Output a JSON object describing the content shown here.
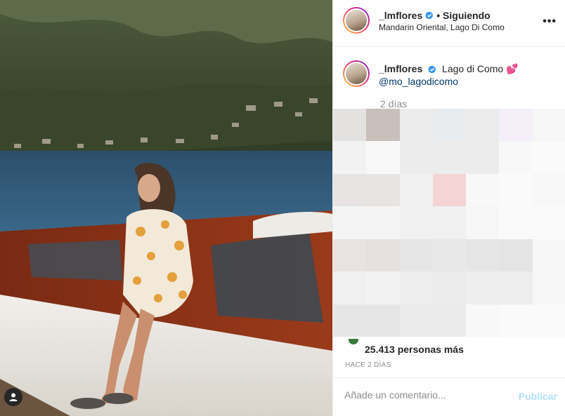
{
  "post": {
    "username": "_lmflores",
    "follow_status": "• Siguiendo",
    "location": "Mandarin Oriental, Lago Di Como",
    "more_label": "•••"
  },
  "caption": {
    "username": "_lmflores",
    "text": "Lago di Como 💕",
    "mention": "@mo_lagodicomo",
    "time_ago": "2 días"
  },
  "stats": {
    "likes_text": "25.413 personas más",
    "date": "HACE 2 DÍAS"
  },
  "comment": {
    "placeholder": "Añade un comentario...",
    "publish_label": "Publicar"
  },
  "colors": {
    "verified": "#3897f0",
    "publish_disabled": "#b2dffc",
    "mention": "#00376b"
  },
  "pixel_colors": [
    "#e4e2e1",
    "#c9bfbb",
    "#ececec",
    "#e9ecef",
    "#ececec",
    "#f4eff8",
    "#f6f6f6",
    "#f2f2f2",
    "#f8f8f8",
    "#ececec",
    "#ececec",
    "#ececec",
    "#f8f8f8",
    "#fafafa",
    "#e6e3e2",
    "#e8e4e2",
    "#f0f0f0",
    "#f4d4d4",
    "#f8f8f8",
    "#fafafa",
    "#f8f8f8",
    "#f4f4f4",
    "#f4f4f4",
    "#f0f0f0",
    "#f0f0f0",
    "#f6f6f6",
    "#fafafa",
    "#fafafa",
    "#e8e2e0",
    "#e6e0de",
    "#e6e6e6",
    "#e8e8e8",
    "#e6e6e6",
    "#e4e4e4",
    "#f6f6f6",
    "#f0f0f0",
    "#f2f2f2",
    "#eeeeee",
    "#ececec",
    "#eeeeee",
    "#ededed",
    "#f6f6f6",
    "#e6e6e6",
    "#e6e6e6",
    "#ebebeb",
    "#ebebeb",
    "#f8f8f8",
    "#fafafa",
    "#fafafa"
  ]
}
